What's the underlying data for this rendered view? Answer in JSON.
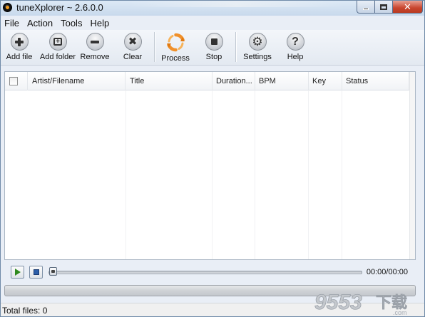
{
  "window": {
    "title": "tuneXplorer ~ 2.6.0.0",
    "controls": {
      "minimize": "minimize",
      "maximize": "maximize",
      "close": "✕"
    }
  },
  "menubar": [
    "File",
    "Action",
    "Tools",
    "Help"
  ],
  "toolbar": {
    "add_file": "Add file",
    "add_folder": "Add folder",
    "remove": "Remove",
    "clear": "Clear",
    "process": "Process",
    "stop": "Stop",
    "settings": "Settings",
    "help": "Help"
  },
  "list": {
    "columns": [
      "Artist/Filename",
      "Title",
      "Duration...",
      "BPM",
      "Key",
      "Status"
    ],
    "rows": []
  },
  "player": {
    "play_icon": "play-icon",
    "stop_icon": "stop-icon",
    "time": "00:00/00:00",
    "seek_position": 0
  },
  "progress": {
    "value": 0
  },
  "status": {
    "text": "Total files: 0"
  },
  "watermark": {
    "main": "9553",
    "suffix": "下载",
    "sub": ".com"
  },
  "colors": {
    "process_orange": "#f0902a",
    "play_green": "#2f8a1e",
    "stop_blue": "#2d5ea8",
    "close_red": "#c8452d"
  }
}
